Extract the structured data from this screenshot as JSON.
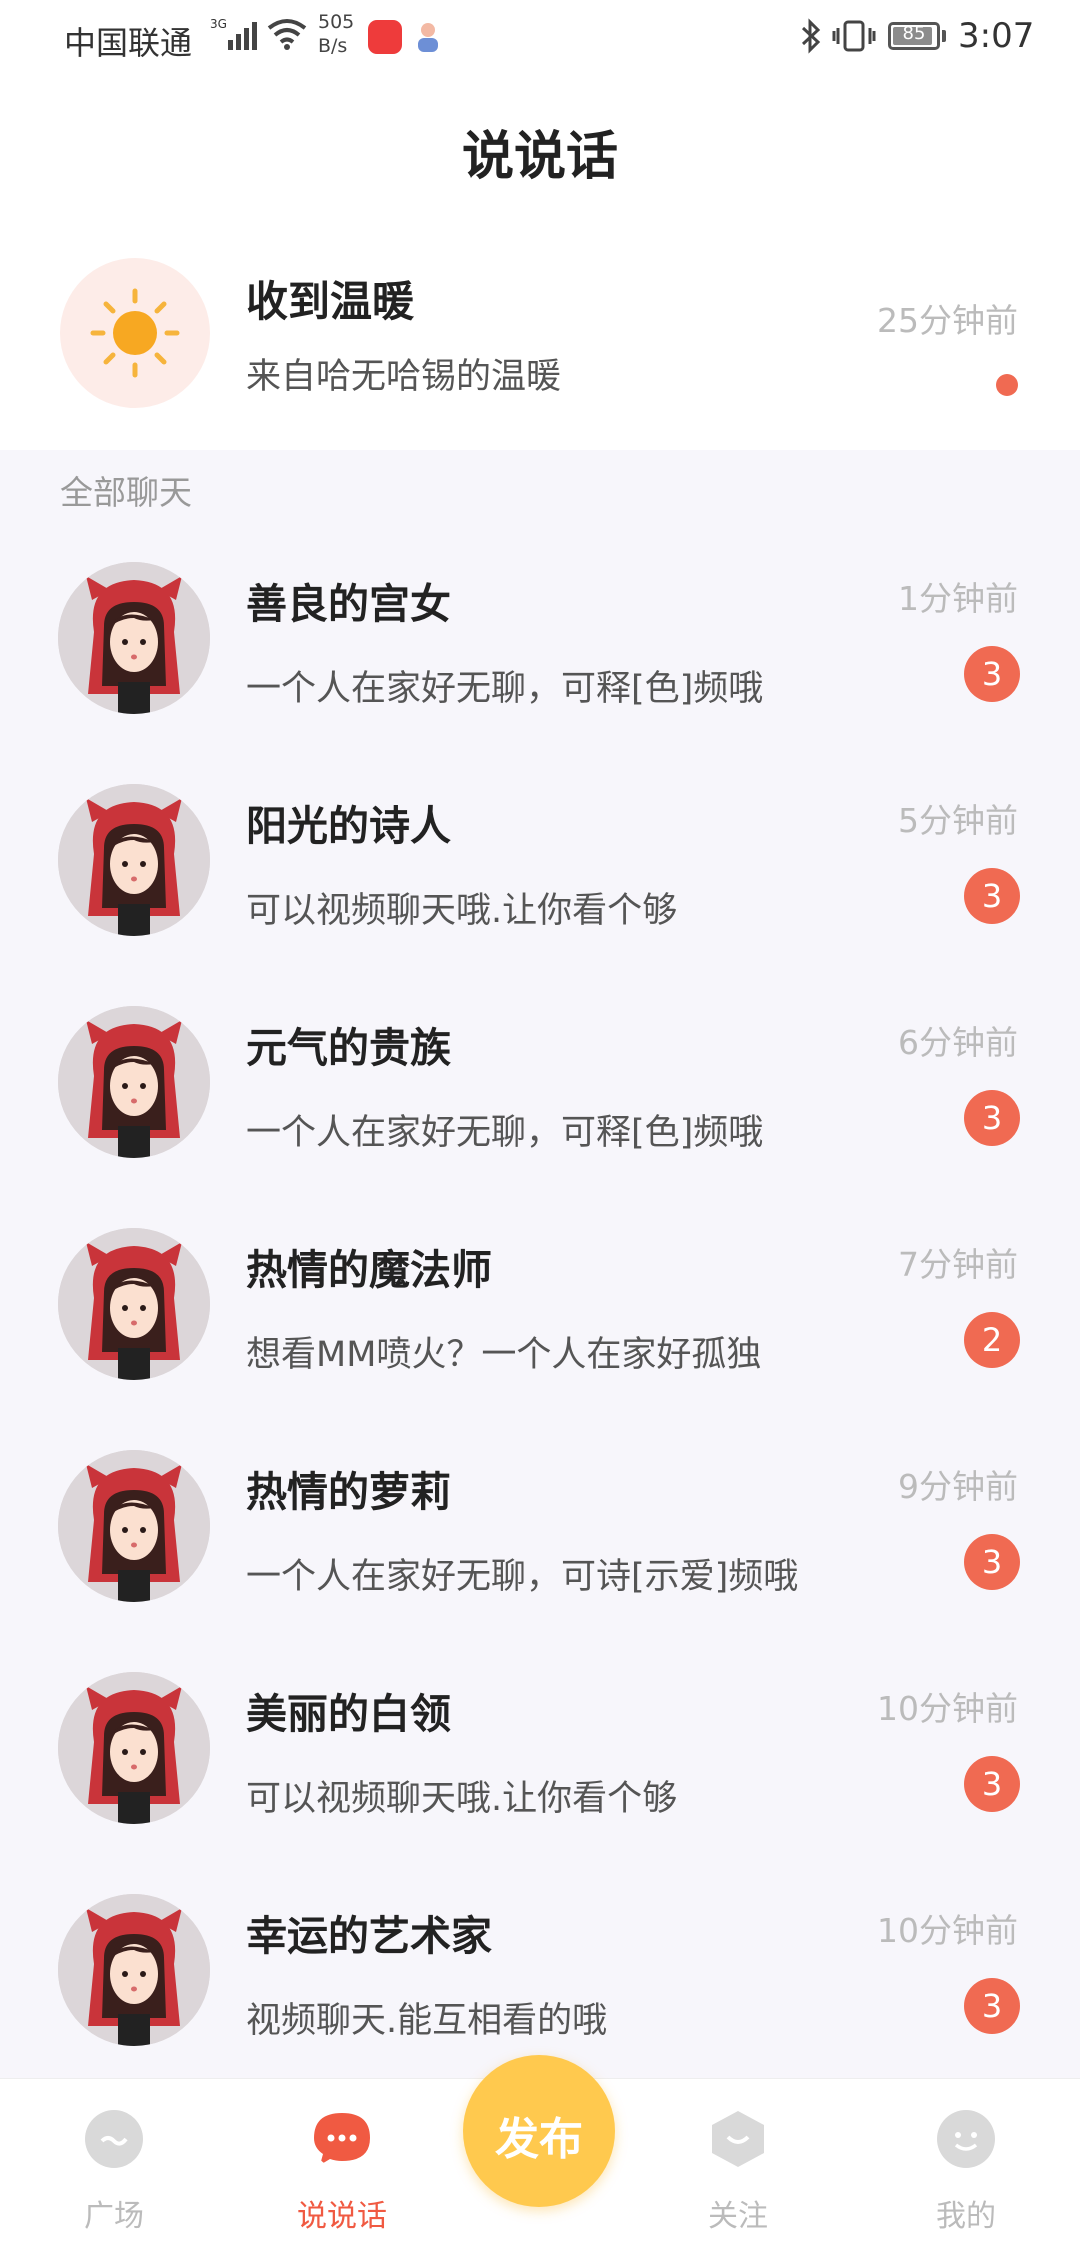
{
  "status_bar": {
    "carrier": "中国联通",
    "network": "3G",
    "speed_value": "505",
    "speed_unit": "B/s",
    "battery": "85",
    "time": "3:07"
  },
  "header": {
    "title": "说说话"
  },
  "warm_notice": {
    "title": "收到温暖",
    "subtitle": "来自哈无哈锡的温暖",
    "time": "25分钟前",
    "icon": "sun-icon"
  },
  "section_label": "全部聊天",
  "chats": [
    {
      "name": "善良的宫女",
      "message": "一个人在家好无聊，可释[色]频哦",
      "time": "1分钟前",
      "unread": "3"
    },
    {
      "name": "阳光的诗人",
      "message": "可以视频聊天哦.让你看个够",
      "time": "5分钟前",
      "unread": "3"
    },
    {
      "name": "元气的贵族",
      "message": "一个人在家好无聊，可释[色]频哦",
      "time": "6分钟前",
      "unread": "3"
    },
    {
      "name": "热情的魔法师",
      "message": "想看MM喷火？一个人在家好孤独",
      "time": "7分钟前",
      "unread": "2"
    },
    {
      "name": "热情的萝莉",
      "message": "一个人在家好无聊，可诗[示爱]频哦",
      "time": "9分钟前",
      "unread": "3"
    },
    {
      "name": "美丽的白领",
      "message": "可以视频聊天哦.让你看个够",
      "time": "10分钟前",
      "unread": "3"
    },
    {
      "name": "幸运的艺术家",
      "message": "视频聊天.能互相看的哦",
      "time": "10分钟前",
      "unread": "3"
    }
  ],
  "bottom_nav": {
    "items": [
      {
        "label": "广场",
        "icon": "plaza-icon",
        "active": false
      },
      {
        "label": "说说话",
        "icon": "chat-bubble-icon",
        "active": true
      },
      {
        "label": "关注",
        "icon": "follow-icon",
        "active": false
      },
      {
        "label": "我的",
        "icon": "profile-icon",
        "active": false
      }
    ],
    "publish_label": "发布"
  },
  "colors": {
    "accent": "#f06a52",
    "publish": "#ffc94e",
    "active_nav": "#f05a42",
    "muted_text": "#bbbbbb"
  }
}
